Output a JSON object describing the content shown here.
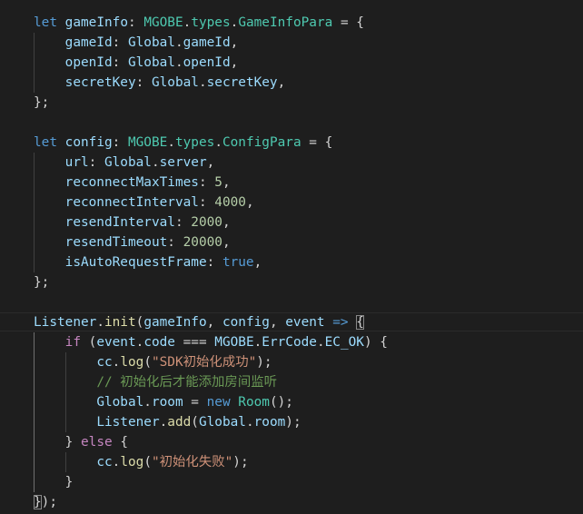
{
  "editor": {
    "lines": [
      [
        {
          "t": "let",
          "c": "kw"
        },
        {
          "t": " ",
          "c": "op"
        },
        {
          "t": "gameInfo",
          "c": "var"
        },
        {
          "t": ": ",
          "c": "op"
        },
        {
          "t": "MGOBE",
          "c": "type"
        },
        {
          "t": ".",
          "c": "op"
        },
        {
          "t": "types",
          "c": "type"
        },
        {
          "t": ".",
          "c": "op"
        },
        {
          "t": "GameInfoPara",
          "c": "type"
        },
        {
          "t": " = {",
          "c": "op"
        }
      ],
      [
        {
          "t": "    ",
          "c": "op"
        },
        {
          "t": "gameId",
          "c": "var"
        },
        {
          "t": ": ",
          "c": "op"
        },
        {
          "t": "Global",
          "c": "var"
        },
        {
          "t": ".",
          "c": "op"
        },
        {
          "t": "gameId",
          "c": "var"
        },
        {
          "t": ",",
          "c": "op"
        }
      ],
      [
        {
          "t": "    ",
          "c": "op"
        },
        {
          "t": "openId",
          "c": "var"
        },
        {
          "t": ": ",
          "c": "op"
        },
        {
          "t": "Global",
          "c": "var"
        },
        {
          "t": ".",
          "c": "op"
        },
        {
          "t": "openId",
          "c": "var"
        },
        {
          "t": ",",
          "c": "op"
        }
      ],
      [
        {
          "t": "    ",
          "c": "op"
        },
        {
          "t": "secretKey",
          "c": "var"
        },
        {
          "t": ": ",
          "c": "op"
        },
        {
          "t": "Global",
          "c": "var"
        },
        {
          "t": ".",
          "c": "op"
        },
        {
          "t": "secretKey",
          "c": "var"
        },
        {
          "t": ",",
          "c": "op"
        }
      ],
      [
        {
          "t": "};",
          "c": "op"
        }
      ],
      [],
      [
        {
          "t": "let",
          "c": "kw"
        },
        {
          "t": " ",
          "c": "op"
        },
        {
          "t": "config",
          "c": "var"
        },
        {
          "t": ": ",
          "c": "op"
        },
        {
          "t": "MGOBE",
          "c": "type"
        },
        {
          "t": ".",
          "c": "op"
        },
        {
          "t": "types",
          "c": "type"
        },
        {
          "t": ".",
          "c": "op"
        },
        {
          "t": "ConfigPara",
          "c": "type"
        },
        {
          "t": " = {",
          "c": "op"
        }
      ],
      [
        {
          "t": "    ",
          "c": "op"
        },
        {
          "t": "url",
          "c": "var"
        },
        {
          "t": ": ",
          "c": "op"
        },
        {
          "t": "Global",
          "c": "var"
        },
        {
          "t": ".",
          "c": "op"
        },
        {
          "t": "server",
          "c": "var"
        },
        {
          "t": ",",
          "c": "op"
        }
      ],
      [
        {
          "t": "    ",
          "c": "op"
        },
        {
          "t": "reconnectMaxTimes",
          "c": "var"
        },
        {
          "t": ": ",
          "c": "op"
        },
        {
          "t": "5",
          "c": "num"
        },
        {
          "t": ",",
          "c": "op"
        }
      ],
      [
        {
          "t": "    ",
          "c": "op"
        },
        {
          "t": "reconnectInterval",
          "c": "var"
        },
        {
          "t": ": ",
          "c": "op"
        },
        {
          "t": "4000",
          "c": "num"
        },
        {
          "t": ",",
          "c": "op"
        }
      ],
      [
        {
          "t": "    ",
          "c": "op"
        },
        {
          "t": "resendInterval",
          "c": "var"
        },
        {
          "t": ": ",
          "c": "op"
        },
        {
          "t": "2000",
          "c": "num"
        },
        {
          "t": ",",
          "c": "op"
        }
      ],
      [
        {
          "t": "    ",
          "c": "op"
        },
        {
          "t": "resendTimeout",
          "c": "var"
        },
        {
          "t": ": ",
          "c": "op"
        },
        {
          "t": "20000",
          "c": "num"
        },
        {
          "t": ",",
          "c": "op"
        }
      ],
      [
        {
          "t": "    ",
          "c": "op"
        },
        {
          "t": "isAutoRequestFrame",
          "c": "var"
        },
        {
          "t": ": ",
          "c": "op"
        },
        {
          "t": "true",
          "c": "kw"
        },
        {
          "t": ",",
          "c": "op"
        }
      ],
      [
        {
          "t": "};",
          "c": "op"
        }
      ],
      [],
      [
        {
          "t": "Listener",
          "c": "var"
        },
        {
          "t": ".",
          "c": "op"
        },
        {
          "t": "init",
          "c": "fn"
        },
        {
          "t": "(",
          "c": "op"
        },
        {
          "t": "gameInfo",
          "c": "var"
        },
        {
          "t": ", ",
          "c": "op"
        },
        {
          "t": "config",
          "c": "var"
        },
        {
          "t": ", ",
          "c": "op"
        },
        {
          "t": "event",
          "c": "var"
        },
        {
          "t": " ",
          "c": "op"
        },
        {
          "t": "=>",
          "c": "arrow"
        },
        {
          "t": " ",
          "c": "op"
        },
        {
          "t": "{",
          "c": "op",
          "m": 1
        }
      ],
      [
        {
          "t": "    ",
          "c": "op"
        },
        {
          "t": "if",
          "c": "ctl"
        },
        {
          "t": " (",
          "c": "op"
        },
        {
          "t": "event",
          "c": "var"
        },
        {
          "t": ".",
          "c": "op"
        },
        {
          "t": "code",
          "c": "var"
        },
        {
          "t": " === ",
          "c": "op"
        },
        {
          "t": "MGOBE",
          "c": "var"
        },
        {
          "t": ".",
          "c": "op"
        },
        {
          "t": "ErrCode",
          "c": "var"
        },
        {
          "t": ".",
          "c": "op"
        },
        {
          "t": "EC_OK",
          "c": "var"
        },
        {
          "t": ") {",
          "c": "op"
        }
      ],
      [
        {
          "t": "        ",
          "c": "op"
        },
        {
          "t": "cc",
          "c": "var"
        },
        {
          "t": ".",
          "c": "op"
        },
        {
          "t": "log",
          "c": "fn"
        },
        {
          "t": "(",
          "c": "op"
        },
        {
          "t": "\"SDK初始化成功\"",
          "c": "str"
        },
        {
          "t": ");",
          "c": "op"
        }
      ],
      [
        {
          "t": "        ",
          "c": "op"
        },
        {
          "t": "// 初始化后才能添加房间监听",
          "c": "cmt"
        }
      ],
      [
        {
          "t": "        ",
          "c": "op"
        },
        {
          "t": "Global",
          "c": "var"
        },
        {
          "t": ".",
          "c": "op"
        },
        {
          "t": "room",
          "c": "var"
        },
        {
          "t": " = ",
          "c": "op"
        },
        {
          "t": "new",
          "c": "kw"
        },
        {
          "t": " ",
          "c": "op"
        },
        {
          "t": "Room",
          "c": "type"
        },
        {
          "t": "();",
          "c": "op"
        }
      ],
      [
        {
          "t": "        ",
          "c": "op"
        },
        {
          "t": "Listener",
          "c": "var"
        },
        {
          "t": ".",
          "c": "op"
        },
        {
          "t": "add",
          "c": "fn"
        },
        {
          "t": "(",
          "c": "op"
        },
        {
          "t": "Global",
          "c": "var"
        },
        {
          "t": ".",
          "c": "op"
        },
        {
          "t": "room",
          "c": "var"
        },
        {
          "t": ");",
          "c": "op"
        }
      ],
      [
        {
          "t": "    ",
          "c": "op"
        },
        {
          "t": "}",
          "c": "op"
        },
        {
          "t": " else ",
          "c": "ctl"
        },
        {
          "t": "{",
          "c": "op"
        }
      ],
      [
        {
          "t": "        ",
          "c": "op"
        },
        {
          "t": "cc",
          "c": "var"
        },
        {
          "t": ".",
          "c": "op"
        },
        {
          "t": "log",
          "c": "fn"
        },
        {
          "t": "(",
          "c": "op"
        },
        {
          "t": "\"初始化失败\"",
          "c": "str"
        },
        {
          "t": ");",
          "c": "op"
        }
      ],
      [
        {
          "t": "    ",
          "c": "op"
        },
        {
          "t": "}",
          "c": "op"
        }
      ],
      [
        {
          "t": "}",
          "c": "op",
          "m": 1
        },
        {
          "t": ");",
          "c": "op"
        }
      ]
    ]
  }
}
